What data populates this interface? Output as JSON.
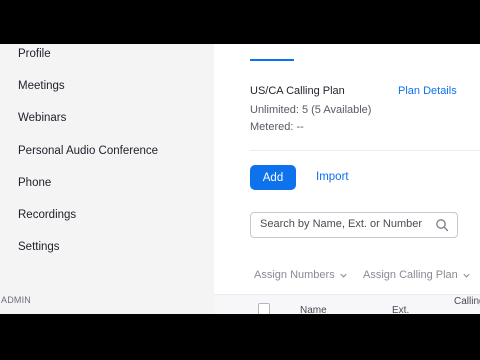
{
  "sidebar": {
    "items": [
      {
        "label": "Profile"
      },
      {
        "label": "Meetings"
      },
      {
        "label": "Webinars"
      },
      {
        "label": "Personal Audio Conference"
      },
      {
        "label": "Phone"
      },
      {
        "label": "Recordings"
      },
      {
        "label": "Settings"
      }
    ],
    "section_label": "ADMIN"
  },
  "plan": {
    "name": "US/CA Calling Plan",
    "details_link": "Plan Details",
    "unlimited": "Unlimited: 5 (5 Available)",
    "metered": "Metered: --"
  },
  "actions": {
    "add_label": "Add",
    "import_label": "Import"
  },
  "search": {
    "placeholder": "Search by Name, Ext. or Number"
  },
  "bulk_actions": {
    "assign_numbers": "Assign Numbers",
    "assign_calling_plan": "Assign Calling Plan"
  },
  "table": {
    "columns": [
      "Name",
      "Ext.",
      "Calling"
    ]
  },
  "colors": {
    "accent": "#0e72ed",
    "sidebar_bg": "#f4f4f5"
  }
}
